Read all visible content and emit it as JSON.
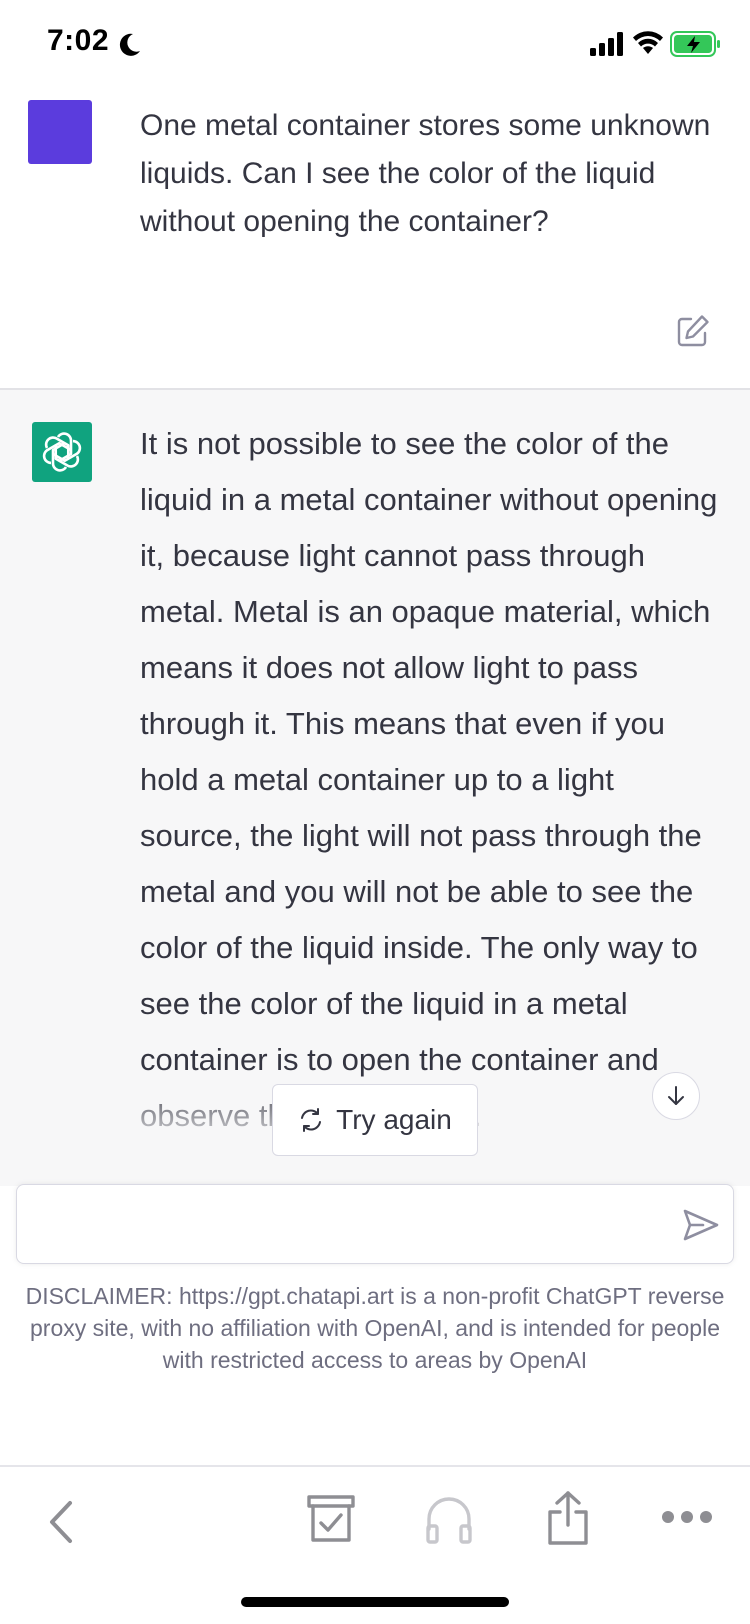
{
  "status_bar": {
    "time": "7:02",
    "icons": [
      "moon-icon",
      "cellular-signal-icon",
      "wifi-icon",
      "battery-charging-icon"
    ],
    "battery_color": "#34c759"
  },
  "conversation": {
    "user": {
      "avatar_color": "#5b3cdd",
      "text": "One metal container stores some unknown liquids. Can I see the color of the liquid without opening the container?",
      "edit_icon": "edit-icon"
    },
    "assistant": {
      "avatar_color": "#10a37f",
      "avatar_icon": "openai-logo-icon",
      "text": "It is not possible to see the color of the liquid in a metal container without opening it, because light cannot pass through metal. Metal is an opaque material, which means it does not allow light to pass through it. This means that even if you hold a metal container up to a light source, the light will not pass through the metal and you will not be able to see the color of the liquid inside. The only way to see the color of the liquid in a metal container is to open the container and observe the liquid inside."
    }
  },
  "actions": {
    "try_again_label": "Try again",
    "try_again_icon": "refresh-icon",
    "scroll_down_icon": "arrow-down-icon"
  },
  "composer": {
    "input_value": "",
    "input_placeholder": "",
    "send_icon": "send-icon"
  },
  "disclaimer": "DISCLAIMER: https://gpt.chatapi.art is a non-profit ChatGPT reverse proxy site, with no affiliation with OpenAI, and is intended for people with restricted access to areas by OpenAI",
  "toolbar": {
    "icons": [
      "back-icon",
      "archive-icon",
      "headphones-icon",
      "share-icon",
      "more-icon"
    ]
  }
}
